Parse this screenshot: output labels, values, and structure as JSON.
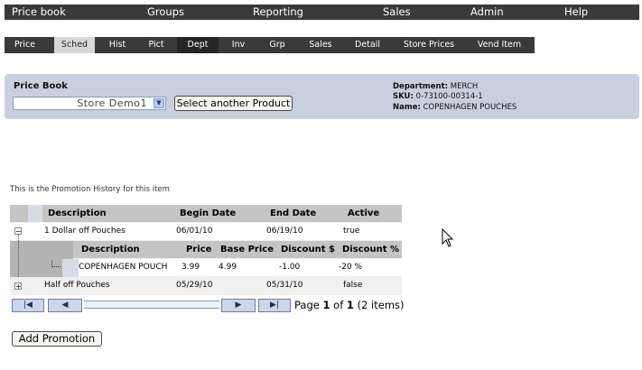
{
  "topnav": [
    "Price book",
    "Groups",
    "Reporting",
    "Sales",
    "Admin",
    "Help"
  ],
  "subnav": [
    "Price",
    "Sched",
    "Hist",
    "Pict",
    "Dept",
    "Inv",
    "Grp",
    "Sales",
    "Detail",
    "Store Prices",
    "Vend Item"
  ],
  "pricebook": {
    "label": "Price Book",
    "store": "Store Demo1",
    "select_button": "Select another Product"
  },
  "product": {
    "department_label": "Department:",
    "department": "MERCH",
    "sku_label": "SKU:",
    "sku": "0-73100-00314-1",
    "name_label": "Name:",
    "name": "COPENHAGEN POUCHES"
  },
  "history_note": "This is the Promotion History for this item",
  "grid": {
    "headers": [
      "Description",
      "Begin Date",
      "End Date",
      "Active"
    ],
    "rows": [
      {
        "expander": "−",
        "description": "1 Dollar off Pouches",
        "begin": "06/01/10",
        "end": "06/19/10",
        "active": "true"
      },
      {
        "expander": "+",
        "description": "Half off Pouches",
        "begin": "05/29/10",
        "end": "05/31/10",
        "active": "false"
      }
    ],
    "detail_headers": [
      "Description",
      "Price",
      "Base Price",
      "Discount $",
      "Discount %"
    ],
    "detail_row": {
      "description": "COPENHAGEN POUCH",
      "price": "3.99",
      "base_price": "4.99",
      "discount_amt": "-1.00",
      "discount_pct": "-20 %"
    }
  },
  "pager": {
    "page_word": "Page",
    "current": "1",
    "of_word": "of",
    "total": "1",
    "items": "(2 items)",
    "first_icon": "first-page-icon",
    "prev_icon": "prev-page-icon",
    "next_icon": "next-page-icon",
    "last_icon": "last-page-icon"
  },
  "add_button": "Add Promotion"
}
